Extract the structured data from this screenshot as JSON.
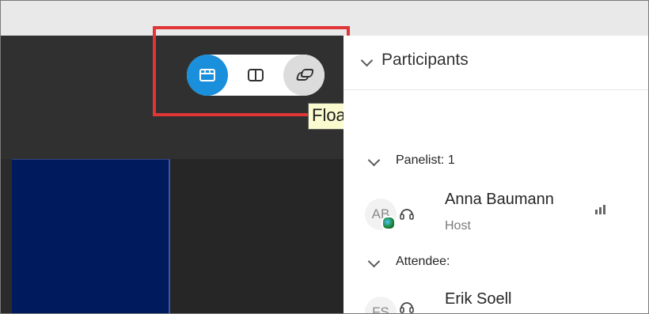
{
  "view_switcher": {
    "stage_icon": "stage-view-icon",
    "side_icon": "side-by-side-view-icon",
    "floating_icon": "floating-panel-view-icon",
    "active_color": "#1a8fdb",
    "highlight_color": "#e03636"
  },
  "tooltip": {
    "text": "Floating panel view"
  },
  "participants_panel": {
    "title": "Participants",
    "sections": [
      {
        "label": "Panelist: 1",
        "people": [
          {
            "initials": "AB",
            "name": "Anna Baumann",
            "role": "Host"
          }
        ]
      },
      {
        "label": "Attendee:",
        "people": [
          {
            "initials": "FS",
            "name": "Erik Soell",
            "role": ""
          }
        ]
      }
    ]
  }
}
